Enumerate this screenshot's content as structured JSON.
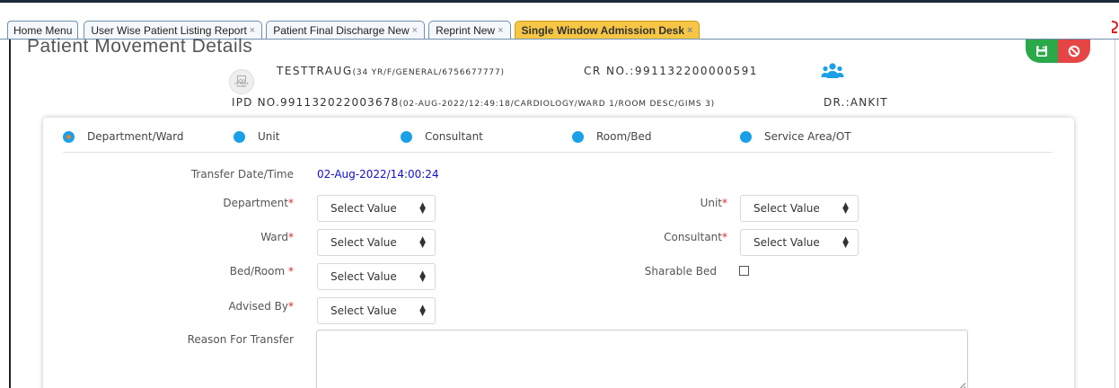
{
  "tabs": [
    {
      "label": "Home Menu",
      "closable": false,
      "active": false
    },
    {
      "label": "User Wise Patient Listing Report",
      "closable": true,
      "active": false
    },
    {
      "label": "Patient Final Discharge New",
      "closable": true,
      "active": false
    },
    {
      "label": "Reprint New",
      "closable": true,
      "active": false
    },
    {
      "label": "Single Window Admission Desk",
      "closable": true,
      "active": true
    }
  ],
  "tab_close_glyph": "×",
  "page_title": "Patient Movement Details",
  "no_image": {
    "line1": "NO IMAGE",
    "line2": "FOUND"
  },
  "patient": {
    "name": "TESTTRAUG",
    "details": "(34 YR/F/GENERAL/6756677777)",
    "cr_no": "CR NO.:991132200000591",
    "ipd_no": "IPD NO.991132022003678",
    "ipd_details": "(02-AUG-2022/12:49:18/CARDIOLOGY/WARD 1/ROOM DESC/GIMS 3)",
    "doctor": "DR.:ANKIT"
  },
  "movement_types": [
    {
      "label": "Department/Ward",
      "selected": true
    },
    {
      "label": "Unit",
      "selected": false
    },
    {
      "label": "Consultant",
      "selected": false
    },
    {
      "label": "Room/Bed",
      "selected": false
    },
    {
      "label": "Service Area/OT",
      "selected": false
    }
  ],
  "form": {
    "transfer_datetime_label": "Transfer Date/Time",
    "transfer_datetime_value": "02-Aug-2022/14:00:24",
    "department_label": "Department",
    "department_value": "Select Value",
    "unit_label": "Unit",
    "unit_value": "Select Value",
    "ward_label": "Ward",
    "ward_value": "Select Value",
    "consultant_label": "Consultant",
    "consultant_value": "Select Value",
    "bed_room_label": "Bed/Room ",
    "bed_room_value": "Select Value",
    "sharable_bed_label": "Sharable Bed",
    "advised_by_label": "Advised By",
    "advised_by_value": "Select Value",
    "reason_label": "Reason For Transfer",
    "required_mark": "*"
  },
  "icons": {
    "save": "save-icon",
    "cancel": "cancel-icon",
    "users": "users-icon",
    "no_image": "no-image-icon"
  },
  "colors": {
    "accent_blue": "#1aa0e8",
    "active_tab": "#f6c644",
    "save_green": "#2aa84a",
    "cancel_red": "#e64545",
    "date_blue": "#1010c8",
    "required_red": "#d9262a"
  }
}
